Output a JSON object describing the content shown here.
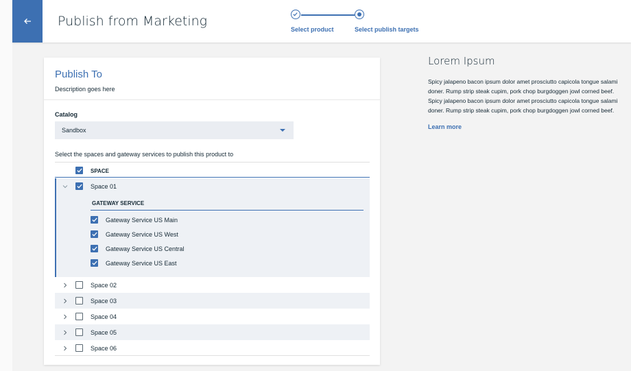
{
  "header": {
    "title": "Publish from Marketing",
    "back_icon": "arrow-left-icon",
    "accent": "#3d70b2",
    "steps": [
      {
        "label": "Select product",
        "state": "complete"
      },
      {
        "label": "Select publish targets",
        "state": "current"
      }
    ]
  },
  "card": {
    "title": "Publish To",
    "description": "Description goes here",
    "catalog_label": "Catalog",
    "catalog_value": "Sandbox",
    "instruction": "Select the spaces and gateway services to publish this product to",
    "space_header": "SPACE",
    "gateway_header": "GATEWAY SERVICE",
    "spaces": [
      {
        "label": "Space 01",
        "checked": true,
        "expanded": true
      },
      {
        "label": "Space 02",
        "checked": false,
        "expanded": false
      },
      {
        "label": "Space 03",
        "checked": false,
        "expanded": false
      },
      {
        "label": "Space 04",
        "checked": false,
        "expanded": false
      },
      {
        "label": "Space 05",
        "checked": false,
        "expanded": false
      },
      {
        "label": "Space 06",
        "checked": false,
        "expanded": false
      }
    ],
    "gateways": [
      {
        "label": "Gateway Service US Main",
        "checked": true
      },
      {
        "label": "Gateway Service US West",
        "checked": true
      },
      {
        "label": "Gateway Service US Central",
        "checked": true
      },
      {
        "label": "Gateway Service US East",
        "checked": true
      }
    ]
  },
  "side": {
    "title": "Lorem Ipsum",
    "body": "Spicy jalapeno bacon ipsum dolor amet prosciutto capicola tongue salami doner. Rump strip steak cupim, pork chop burgdoggen jowl corned beef. Spicy jalapeno bacon ipsum dolor amet prosciutto capicola tongue salami doner. Rump strip steak cupim, pork chop burgdoggen jowl corned beef.",
    "link": "Learn more"
  }
}
